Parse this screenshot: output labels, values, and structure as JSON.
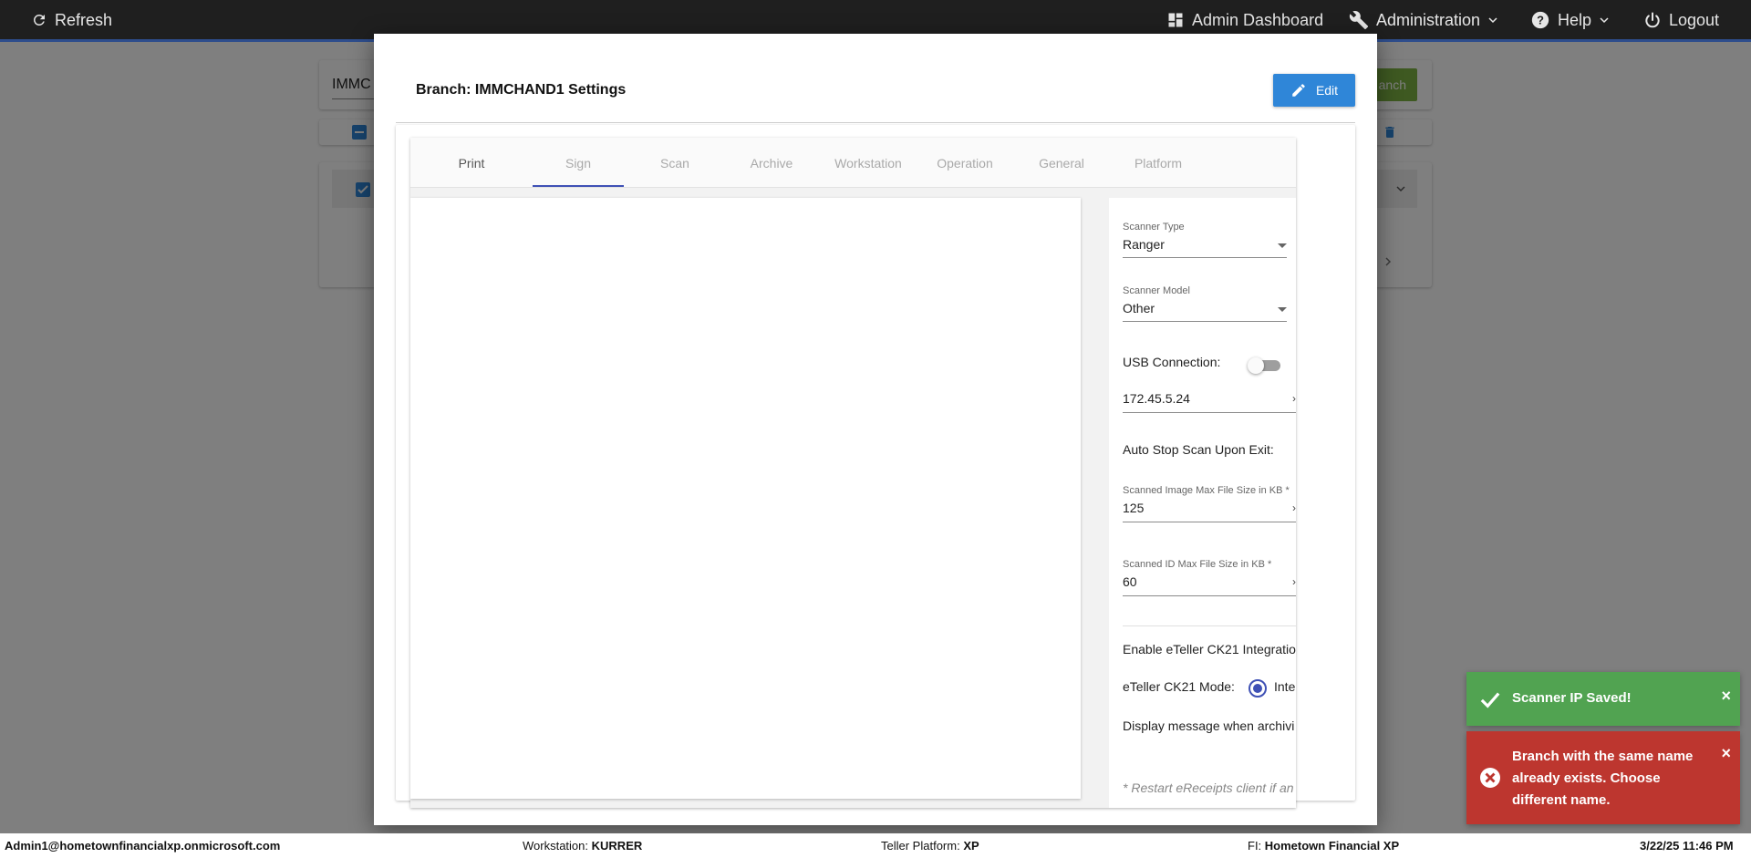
{
  "topbar": {
    "refresh_label": "Refresh",
    "admin_dashboard_label": "Admin Dashboard",
    "administration_label": "Administration",
    "help_label": "Help",
    "logout_label": "Logout"
  },
  "background": {
    "search_value": "IMMC",
    "add_branch_label": "anch"
  },
  "modal": {
    "title": "Branch: IMMCHAND1 Settings",
    "edit_label": "Edit",
    "tabs": [
      {
        "label": "Print"
      },
      {
        "label": "Sign"
      },
      {
        "label": "Scan"
      },
      {
        "label": "Archive"
      },
      {
        "label": "Workstation"
      },
      {
        "label": "Operation"
      },
      {
        "label": "General"
      },
      {
        "label": "Platform"
      }
    ],
    "active_tab": "Sign",
    "settings": {
      "scanner_type_label": "Scanner Type",
      "scanner_type_value": "Ranger",
      "scanner_model_label": "Scanner Model",
      "scanner_model_value": "Other",
      "usb_connection_label": "USB Connection:",
      "usb_connection_on": false,
      "scanner_ip_value": "172.45.5.24",
      "auto_stop_label": "Auto Stop Scan Upon Exit:",
      "image_max_label": "Scanned Image Max File Size in KB *",
      "image_max_value": "125",
      "id_max_label": "Scanned ID Max File Size in KB *",
      "id_max_value": "60",
      "ck21_integration_label": "Enable eTeller CK21 Integratio",
      "ck21_mode_label": "eTeller CK21 Mode:",
      "ck21_mode_option": "Inte",
      "display_message_label": "Display message when archivi",
      "restart_note": "* Restart eReceipts client if an"
    }
  },
  "toasts": {
    "success_message": "Scanner IP Saved!",
    "error_message": "Branch with the same name already exists. Choose different name.",
    "close_glyph": "×"
  },
  "statusbar": {
    "user": "Admin1@hometownfinancialxp.onmicrosoft.com",
    "workstation_label": "Workstation:",
    "workstation_value": "KURRER",
    "teller_platform_label": "Teller Platform:",
    "teller_platform_value": "XP",
    "fi_label": "FI:",
    "fi_value": "Hometown Financial XP",
    "datetime": "3/22/25 11:46 PM"
  },
  "colors": {
    "topbar_bg": "#1f1f1f",
    "edit_button": "#2f86d8",
    "active_tab_underline": "#3f51b5",
    "toast_success": "#51a351",
    "toast_error": "#bd362f",
    "add_branch_green": "#7cb342"
  }
}
